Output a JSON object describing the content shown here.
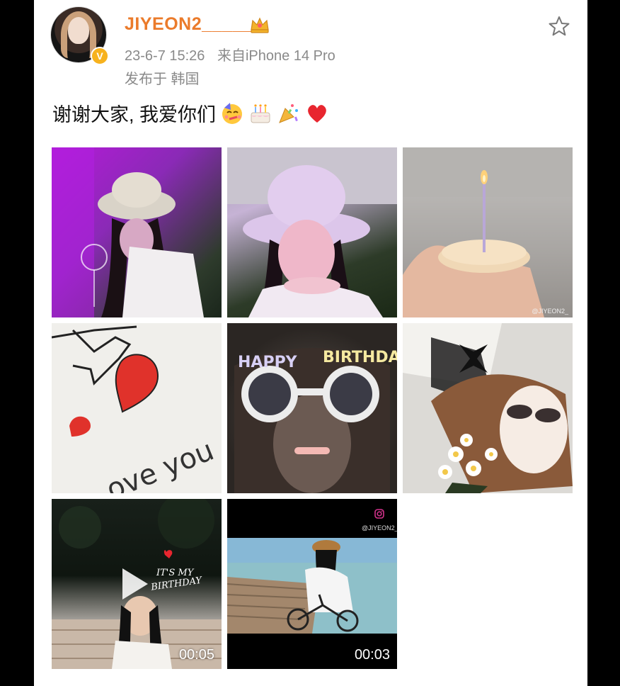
{
  "post": {
    "username": "JIYEON2_____",
    "date": "23-6-7 15:26",
    "source": "来自iPhone 14 Pro",
    "location": "发布于 韩国",
    "text": "谢谢大家, 我爱你们",
    "emojis": [
      "partying-face",
      "birthday-cake",
      "party-popper",
      "red-heart"
    ]
  },
  "images": [
    {
      "name": "photo-bucket-hat-purple-light"
    },
    {
      "name": "photo-bucket-hat-selfie"
    },
    {
      "name": "photo-pie-with-candle",
      "watermark": "@JIYEON2_"
    },
    {
      "name": "photo-love-you-card"
    },
    {
      "name": "photo-birthday-glasses"
    },
    {
      "name": "photo-illustration-with-flowers"
    },
    {
      "name": "video-its-my-birthday",
      "duration": "00:05",
      "overlay_text": "IT'S MY BIRTHDAY"
    },
    {
      "name": "video-beach-bicycle",
      "duration": "00:03",
      "handle": "@JIYEON2_"
    }
  ],
  "colors": {
    "username": "#eb7b2b",
    "meta": "#8a8a8a",
    "verified_badge": "#f7b21e"
  }
}
